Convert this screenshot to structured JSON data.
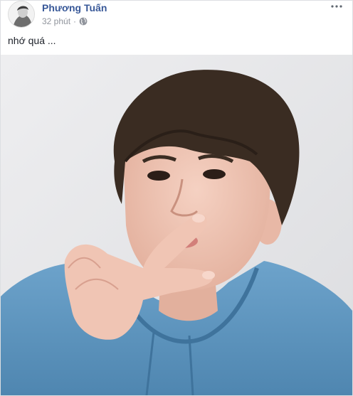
{
  "post": {
    "author_name": "Phương Tuấn",
    "timestamp": "32 phút",
    "separator": "·",
    "privacy_icon": "globe-icon",
    "caption": "nhớ quá ...",
    "more_icon": "more-options-icon",
    "photo": {
      "subject": "selfie",
      "colors": {
        "background": "#e9eaec",
        "hoodie": "#5b93bd",
        "hair": "#3a2c22",
        "skin": "#edc2b1"
      }
    }
  }
}
